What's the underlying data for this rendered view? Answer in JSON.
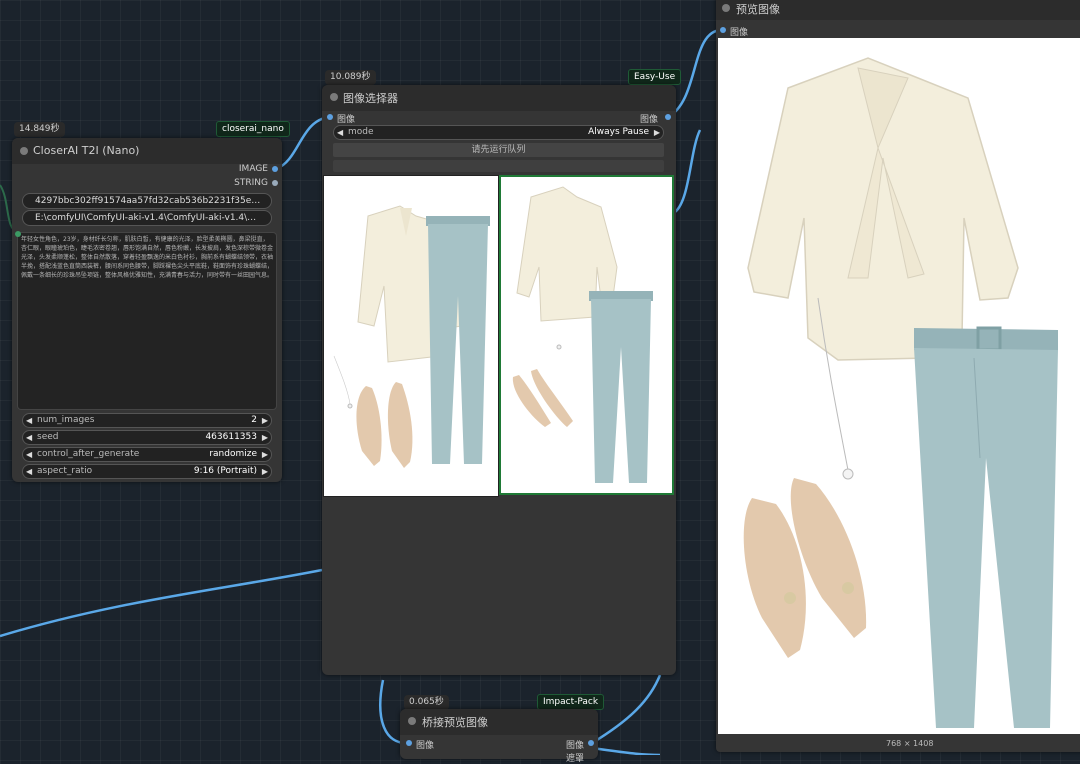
{
  "colors": {
    "canvas": "#1b232c",
    "node_bg": "#353535",
    "link_blue": "#5aa8e8",
    "badge_green": "#1f5a36",
    "blouse": "#f3eedc",
    "pants": "#a6c2c6",
    "shoe": "#e3c9ad"
  },
  "closerai_node": {
    "timing": "14.849秒",
    "badge": "closerai_nano",
    "title": "CloserAI T2I (Nano)",
    "outputs": [
      "IMAGE",
      "STRING"
    ],
    "field_key": "4297bbc302ff91574aa57fd32cab536b2231f35e53ef36b9...",
    "field_path": "E:\\comfyUI\\ComfyUI-aki-v1.4\\ComfyUI-aki-v1.4\\custom_...",
    "prompt": "年轻女性角色，23岁，身材纤长匀称，肌肤白皙，有健康的光泽，脸型柔美椭圆，鼻梁挺直，杏仁眼，眼瞳琥珀色，睫毛浓密卷翘，唇形饱满自然，唇色粉嫩，长发披肩，发色深棕带微卷金光泽，头发柔顺蓬松，整体自然散落，穿着轻盈飘逸的米白色衬衫，胸前系有蝴蝶结领带，衣袖半挽，搭配浅蓝色直筒西装裤，腰间系同色腰带，脚踩裸色尖头平底鞋，鞋面饰有珍珠蝴蝶结，佩戴一条细长的珍珠吊坠项链，整体风格优雅知性，充满青春与活力，同时带有一丝田园气息。",
    "widgets": [
      {
        "label": "num_images",
        "value": "2"
      },
      {
        "label": "seed",
        "value": "463611353"
      },
      {
        "label": "control_after_generate",
        "value": "randomize"
      },
      {
        "label": "aspect_ratio",
        "value": "9:16 (Portrait)"
      }
    ]
  },
  "selector_node": {
    "timing": "10.089秒",
    "badge": "Easy-Use",
    "title": "图像选择器",
    "input_label": "图像",
    "output_label": "图像",
    "mode_label": "mode",
    "mode_value": "Always Pause",
    "run_queue_button": "请先运行队列"
  },
  "preview_node": {
    "title": "预览图像",
    "input_label": "图像",
    "size_text": "768 × 1408"
  },
  "bridge_node": {
    "timing": "0.065秒",
    "badge": "Impact-Pack",
    "title": "桥接预览图像",
    "input_label": "图像",
    "output_label": "图像",
    "output2_label": "遮罩"
  }
}
